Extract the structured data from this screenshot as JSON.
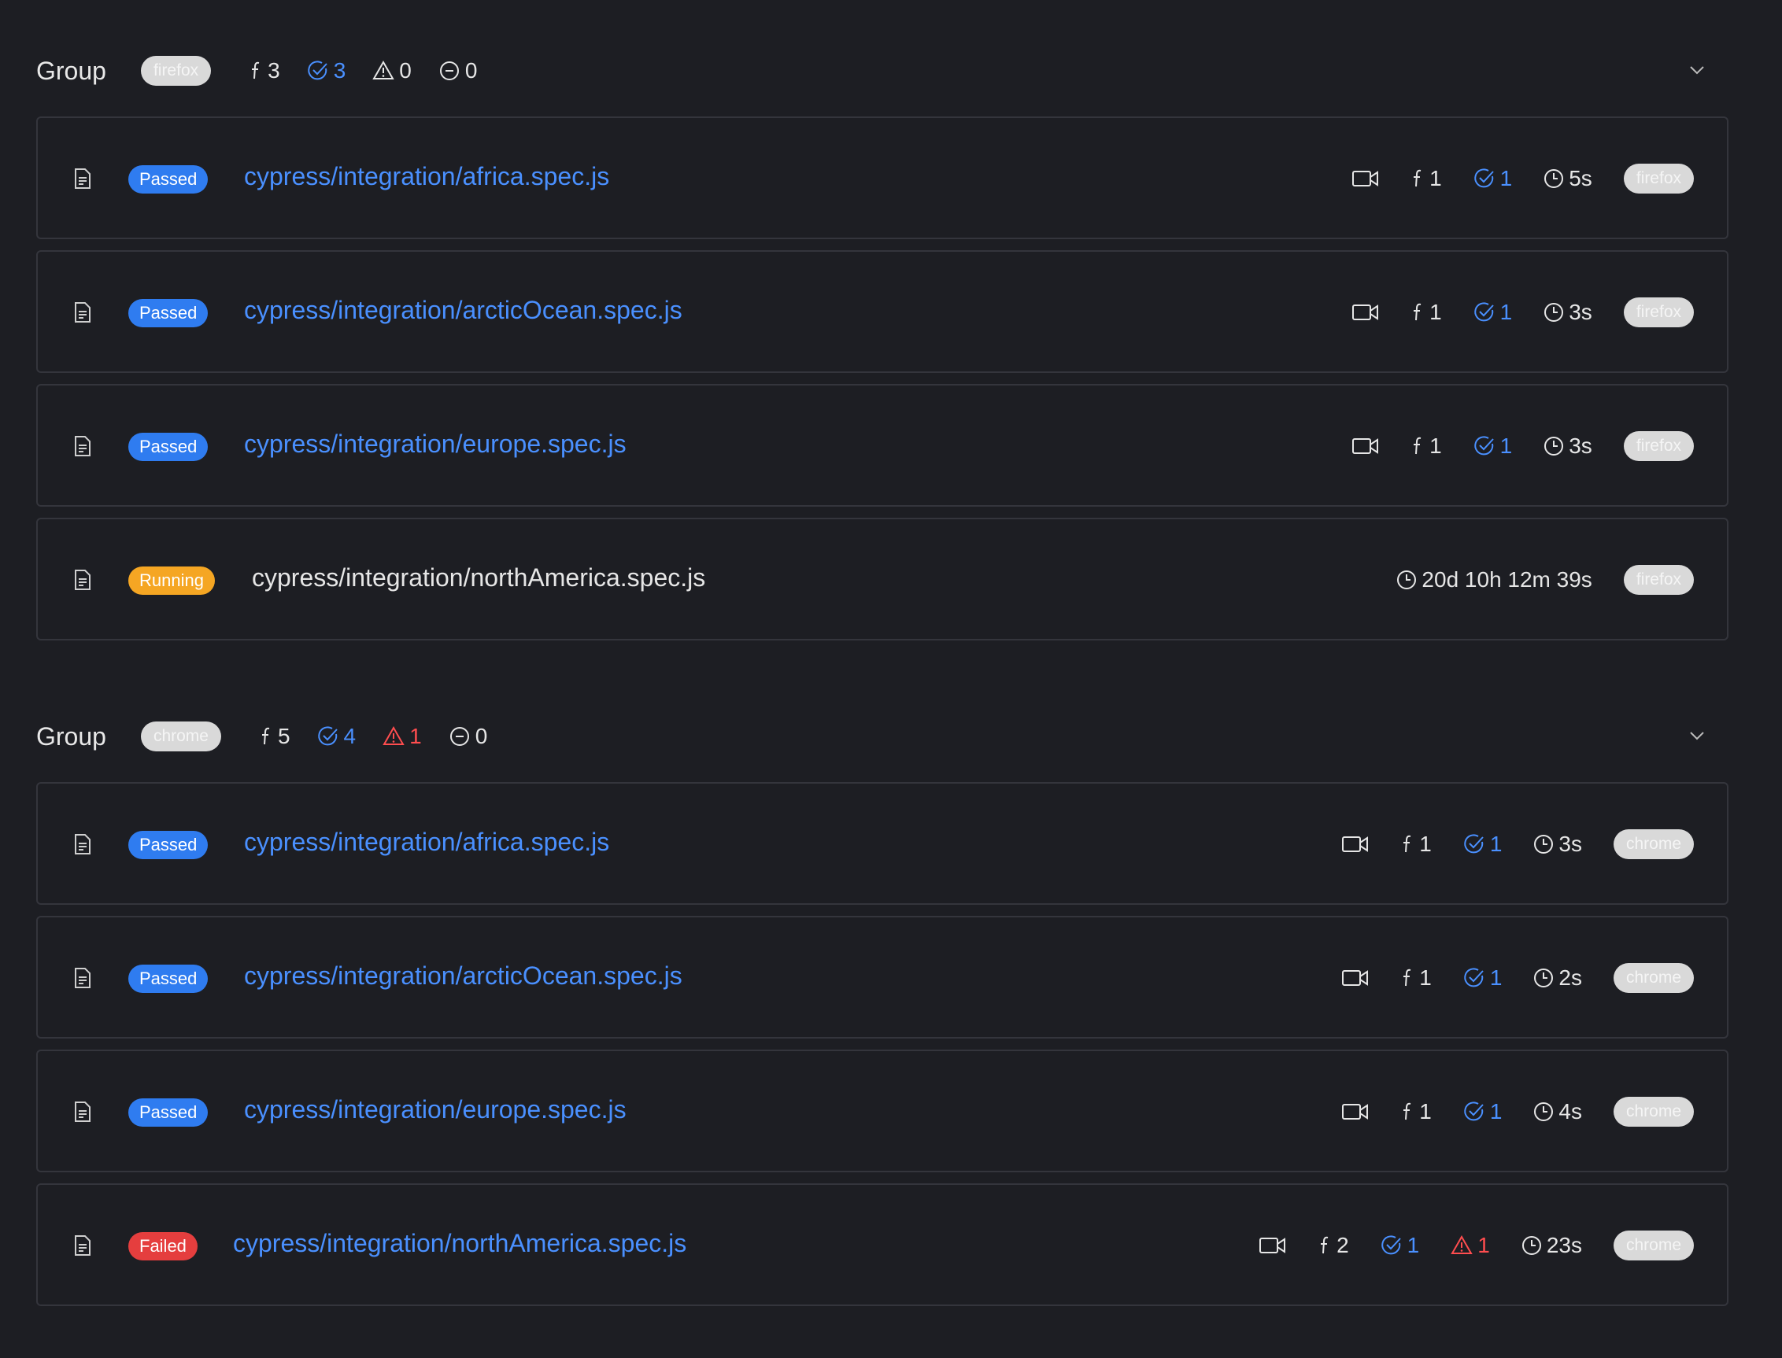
{
  "groups": [
    {
      "title": "Group",
      "browser": "firefox",
      "stats": {
        "tests": "3",
        "passed": "3",
        "failed": "0",
        "skipped": "0"
      },
      "rows": [
        {
          "status": "Passed",
          "spec": "cypress/integration/africa.spec.js",
          "tests": "1",
          "passed": "1",
          "failed": "",
          "duration": "5s",
          "browser": "firefox",
          "video": true
        },
        {
          "status": "Passed",
          "spec": "cypress/integration/arcticOcean.spec.js",
          "tests": "1",
          "passed": "1",
          "failed": "",
          "duration": "3s",
          "browser": "firefox",
          "video": true
        },
        {
          "status": "Passed",
          "spec": "cypress/integration/europe.spec.js",
          "tests": "1",
          "passed": "1",
          "failed": "",
          "duration": "3s",
          "browser": "firefox",
          "video": true
        },
        {
          "status": "Running",
          "spec": "cypress/integration/northAmerica.spec.js",
          "tests": "",
          "passed": "",
          "failed": "",
          "duration": "20d 10h 12m 39s",
          "browser": "firefox",
          "video": false
        }
      ]
    },
    {
      "title": "Group",
      "browser": "chrome",
      "stats": {
        "tests": "5",
        "passed": "4",
        "failed": "1",
        "skipped": "0"
      },
      "rows": [
        {
          "status": "Passed",
          "spec": "cypress/integration/africa.spec.js",
          "tests": "1",
          "passed": "1",
          "failed": "",
          "duration": "3s",
          "browser": "chrome",
          "video": true
        },
        {
          "status": "Passed",
          "spec": "cypress/integration/arcticOcean.spec.js",
          "tests": "1",
          "passed": "1",
          "failed": "",
          "duration": "2s",
          "browser": "chrome",
          "video": true
        },
        {
          "status": "Passed",
          "spec": "cypress/integration/europe.spec.js",
          "tests": "1",
          "passed": "1",
          "failed": "",
          "duration": "4s",
          "browser": "chrome",
          "video": true
        },
        {
          "status": "Failed",
          "spec": "cypress/integration/northAmerica.spec.js",
          "tests": "2",
          "passed": "1",
          "failed": "1",
          "duration": "23s",
          "browser": "chrome",
          "video": true
        }
      ]
    }
  ],
  "colors": {
    "background": "#1d1e23",
    "passed": "#2f7cf0",
    "running": "#f5a623",
    "failed": "#e53e3e",
    "link": "#4a90ff"
  },
  "icons": [
    "document-icon",
    "video-icon",
    "function-icon",
    "check-circle-icon",
    "warning-icon",
    "minus-circle-icon",
    "clock-icon",
    "chevron-down-icon"
  ]
}
